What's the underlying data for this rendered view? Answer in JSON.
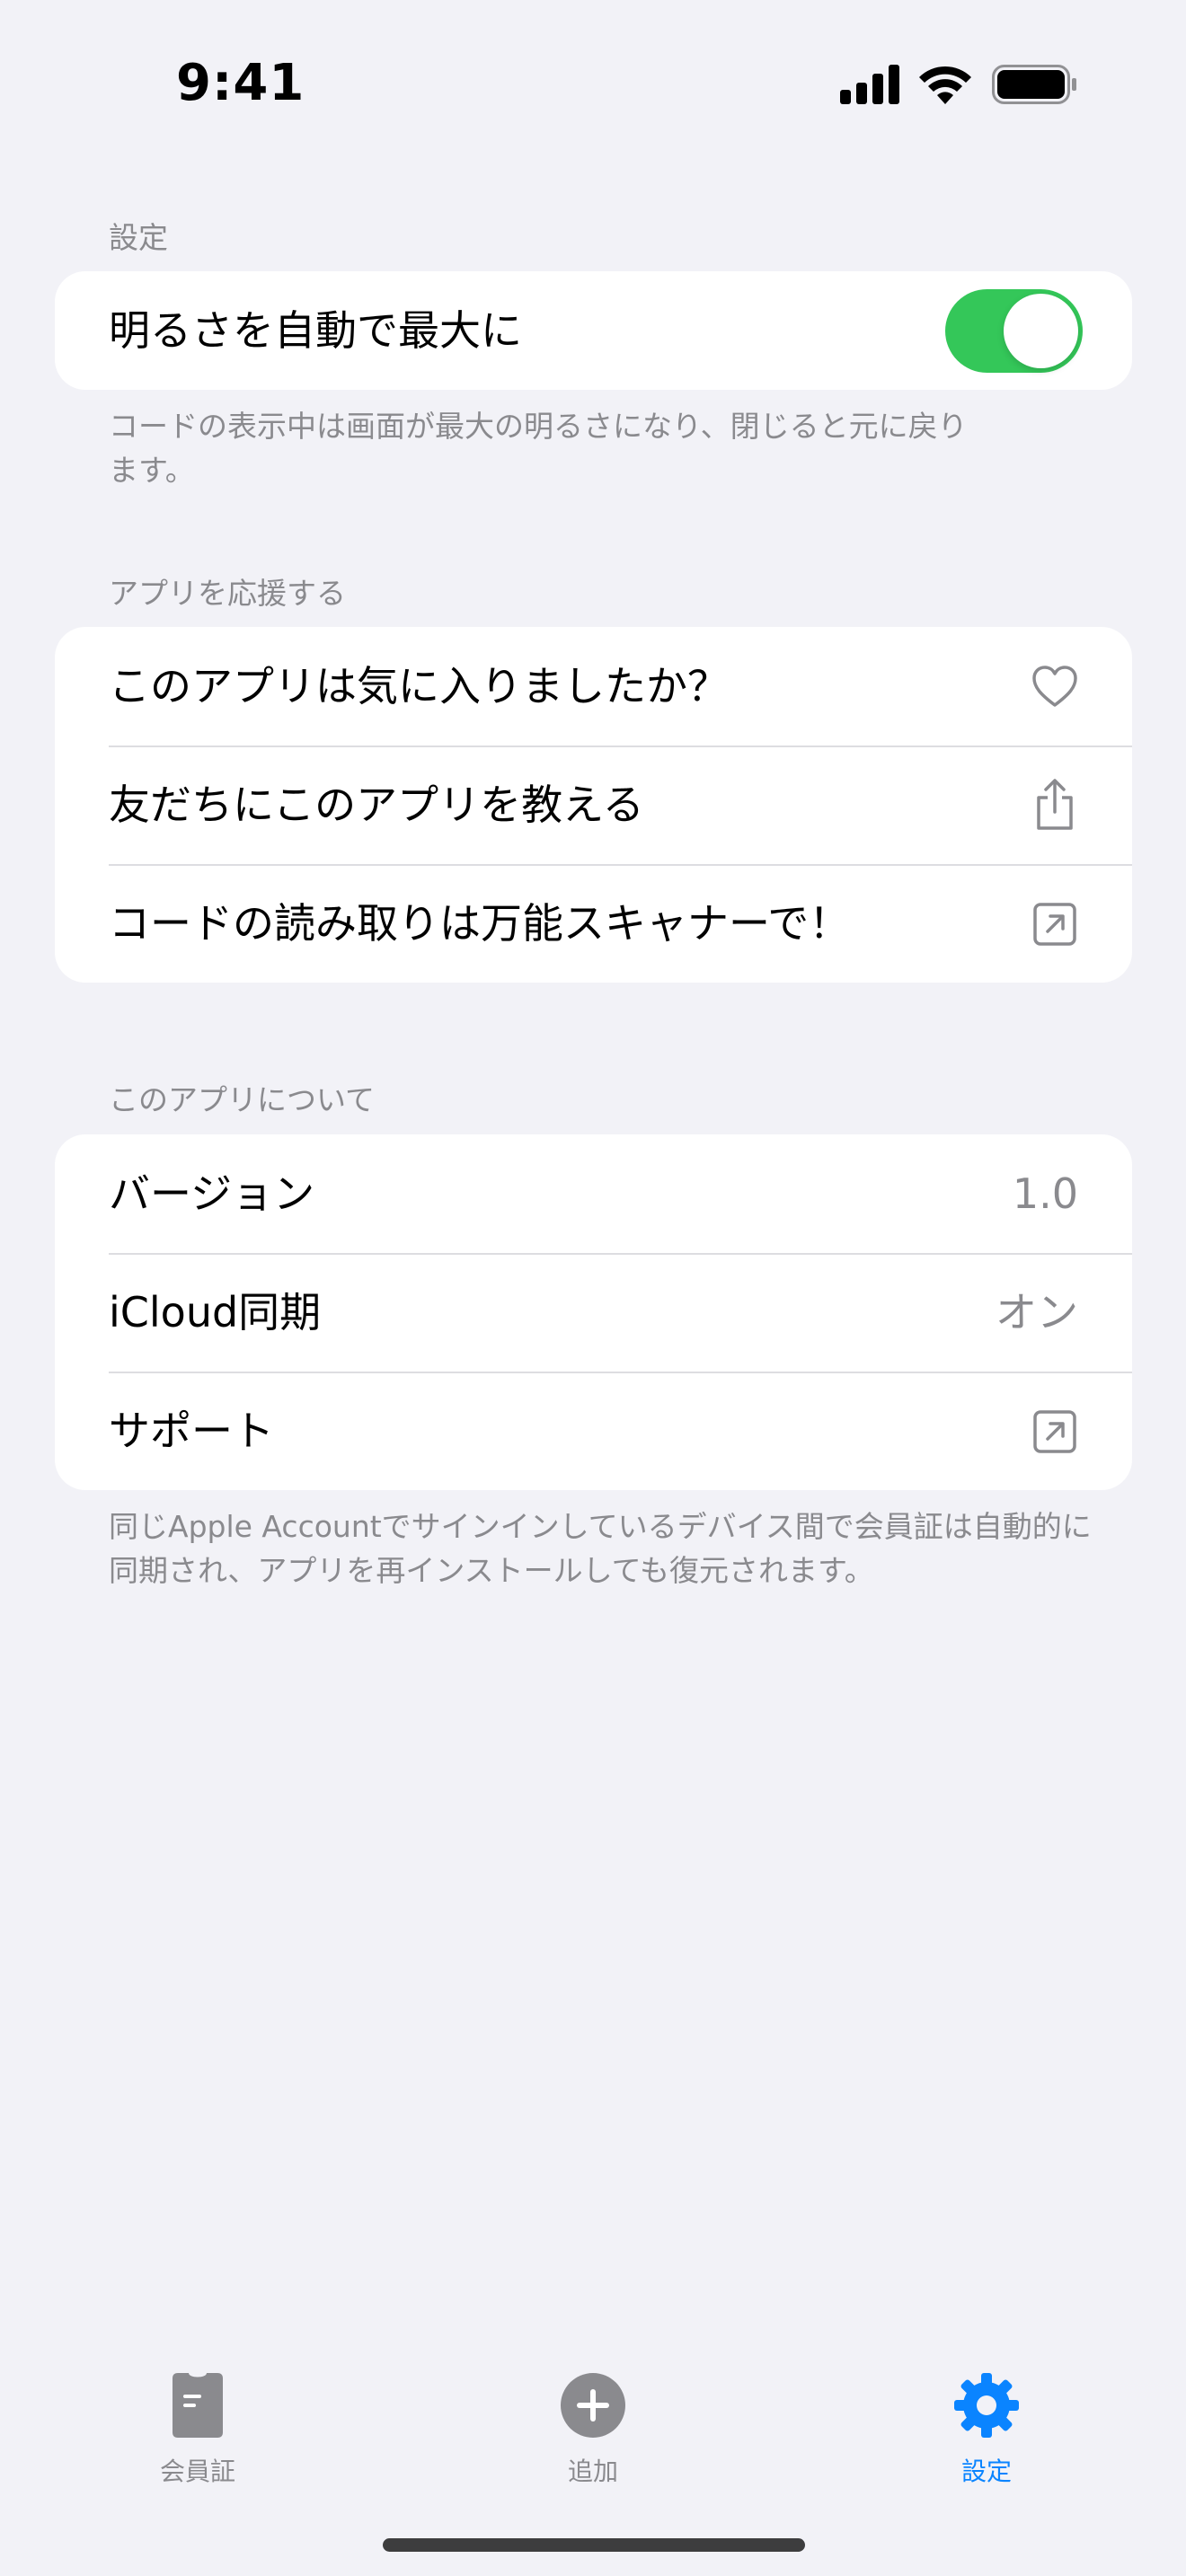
{
  "status_bar": {
    "time": "9:41"
  },
  "settings_section": {
    "header": "設定",
    "auto_brightness_label": "明るさを自動で最大に",
    "auto_brightness_on": true,
    "footer": "コードの表示中は画面が最大の明るさになり、閉じると元に戻ります。"
  },
  "support_section": {
    "header": "アプリを応援する",
    "rows": [
      {
        "label": "このアプリは気に入りましたか？",
        "icon": "heart-icon"
      },
      {
        "label": "友だちにこのアプリを教える",
        "icon": "share-icon"
      },
      {
        "label": "コードの読み取りは万能スキャナーで！",
        "icon": "external-link-icon"
      }
    ]
  },
  "about_section": {
    "header": "このアプリについて",
    "version_label": "バージョン",
    "version_value": "1.0",
    "icloud_label": "iCloud同期",
    "icloud_value": "オン",
    "support_label": "サポート",
    "support_icon": "external-link-icon",
    "footer": "同じApple Accountでサインインしているデバイス間で会員証は自動的に同期され、アプリを再インストールしても復元されます。"
  },
  "tab_bar": {
    "tabs": [
      {
        "label": "会員証",
        "icon": "card-icon",
        "active": false
      },
      {
        "label": "追加",
        "icon": "plus-circle-icon",
        "active": false
      },
      {
        "label": "設定",
        "icon": "gear-icon",
        "active": true
      }
    ]
  },
  "colors": {
    "accent": "#0A84FF",
    "toggle_on": "#34C759",
    "background": "#F2F2F7",
    "secondary_text": "#8A8A8E"
  }
}
